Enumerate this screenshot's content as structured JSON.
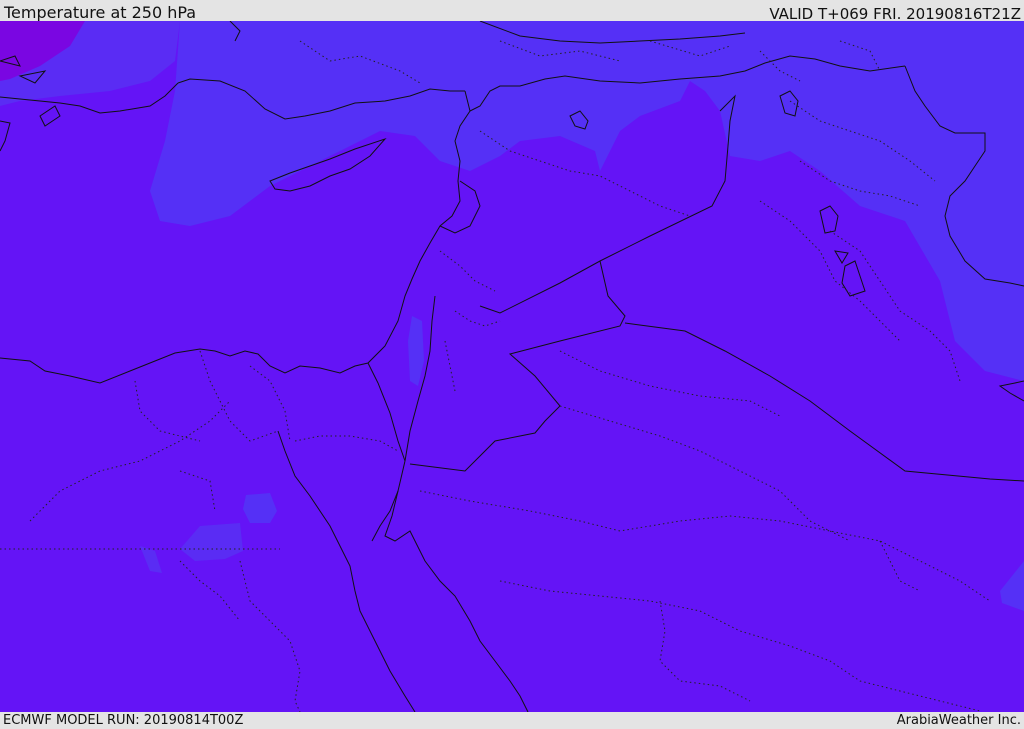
{
  "header": {
    "title": "Temperature at 250 hPa",
    "valid": "VALID T+069 FRI. 20190816T21Z"
  },
  "footer": {
    "model_run": "ECMWF MODEL RUN: 20190814T00Z",
    "credit": "ArabiaWeather Inc."
  },
  "colors": {
    "base_fill": "#6414f6",
    "cooler_fill": "#5530f6",
    "coldest_fill": "#7a06e2",
    "header_background": "#e4e4e4"
  }
}
